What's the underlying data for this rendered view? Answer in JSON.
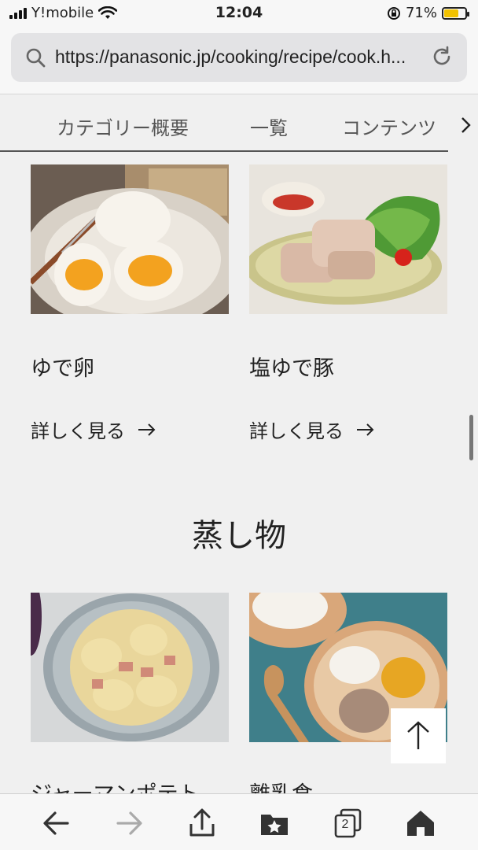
{
  "status_bar": {
    "carrier": "Y!mobile",
    "time": "12:04",
    "battery": "71%"
  },
  "url_bar": {
    "url": "https://panasonic.jp/cooking/recipe/cook.h..."
  },
  "category_nav": {
    "tabs": [
      "カテゴリー概要",
      "一覧",
      "コンテンツ"
    ]
  },
  "cards_row1": [
    {
      "title": "ゆで卵",
      "link": "詳しく見る"
    },
    {
      "title": "塩ゆで豚",
      "link": "詳しく見る"
    }
  ],
  "section": {
    "title": "蒸し物"
  },
  "cards_row2": [
    {
      "title": "ジャーマンポテト"
    },
    {
      "title": "離乳食"
    }
  ],
  "toolbar": {
    "tab_count": "2"
  },
  "icons": [
    "signal-icon",
    "wifi-icon",
    "rotation-lock-icon",
    "battery-icon",
    "search-icon",
    "reload-icon",
    "chevron-right-icon",
    "arrow-right-icon",
    "arrow-up-icon",
    "back-icon",
    "forward-icon",
    "share-icon",
    "bookmarks-icon",
    "tabs-icon",
    "home-icon"
  ],
  "colors": {
    "background": "#f0f0f0",
    "battery_fill": "#f2c200",
    "text": "#222222"
  }
}
